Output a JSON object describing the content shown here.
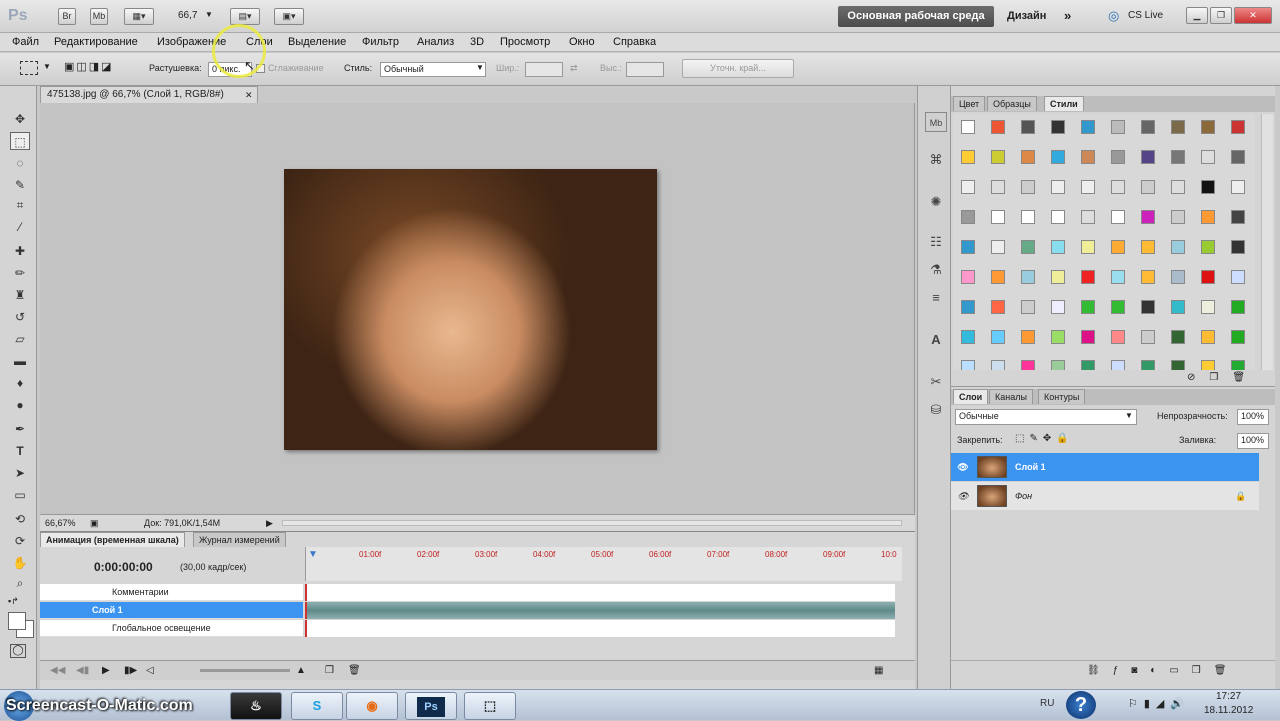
{
  "topbar": {
    "ps": "Ps",
    "br": "Br",
    "mb": "Mb",
    "zoom": "66,7",
    "workspace": "Основная рабочая среда",
    "design": "Дизайн",
    "cslive": "CS Live"
  },
  "menu": [
    "Файл",
    "Редактирование",
    "Изображение",
    "Слои",
    "Выделение",
    "Фильтр",
    "Анализ",
    "3D",
    "Просмотр",
    "Окно",
    "Справка"
  ],
  "options": {
    "feather_label": "Растушевка:",
    "feather_value": "0 пикс.",
    "antialias": "Сглаживание",
    "style_label": "Стиль:",
    "style_value": "Обычный",
    "width_label": "Шир.:",
    "height_label": "Выс.:",
    "refine": "Уточн. край..."
  },
  "document": {
    "tab": "475138.jpg @ 66,7% (Слой 1, RGB/8#)",
    "zoom": "66,67%",
    "doc_info": "Док: 791,0K/1,54M"
  },
  "animation": {
    "tab1": "Анимация (временная шкала)",
    "tab2": "Журнал измерений",
    "time": "0:00:00:00",
    "fps": "(30,00 кадр/сек)",
    "ticks": [
      "01:00f",
      "02:00f",
      "03:00f",
      "04:00f",
      "05:00f",
      "06:00f",
      "07:00f",
      "08:00f",
      "09:00f",
      "10:0"
    ],
    "rows": [
      "Комментарии",
      "Слой 1",
      "Глобальное освещение"
    ]
  },
  "styles_panel": {
    "tabs": [
      "Цвет",
      "Образцы",
      "Стили"
    ]
  },
  "layers_panel": {
    "tabs": [
      "Слои",
      "Каналы",
      "Контуры"
    ],
    "blend": "Обычные",
    "opacity_label": "Непрозрачность:",
    "opacity": "100%",
    "lock_label": "Закрепить:",
    "fill_label": "Заливка:",
    "fill": "100%",
    "layers": [
      "Слой 1",
      "Фон"
    ]
  },
  "taskbar": {
    "lang": "RU",
    "time": "17:27",
    "date": "18.11.2012",
    "watermark": "Screencast-O-Matic.com"
  },
  "colors": {
    "selection": "#3b95f0",
    "accent": "#4c4c4c"
  }
}
